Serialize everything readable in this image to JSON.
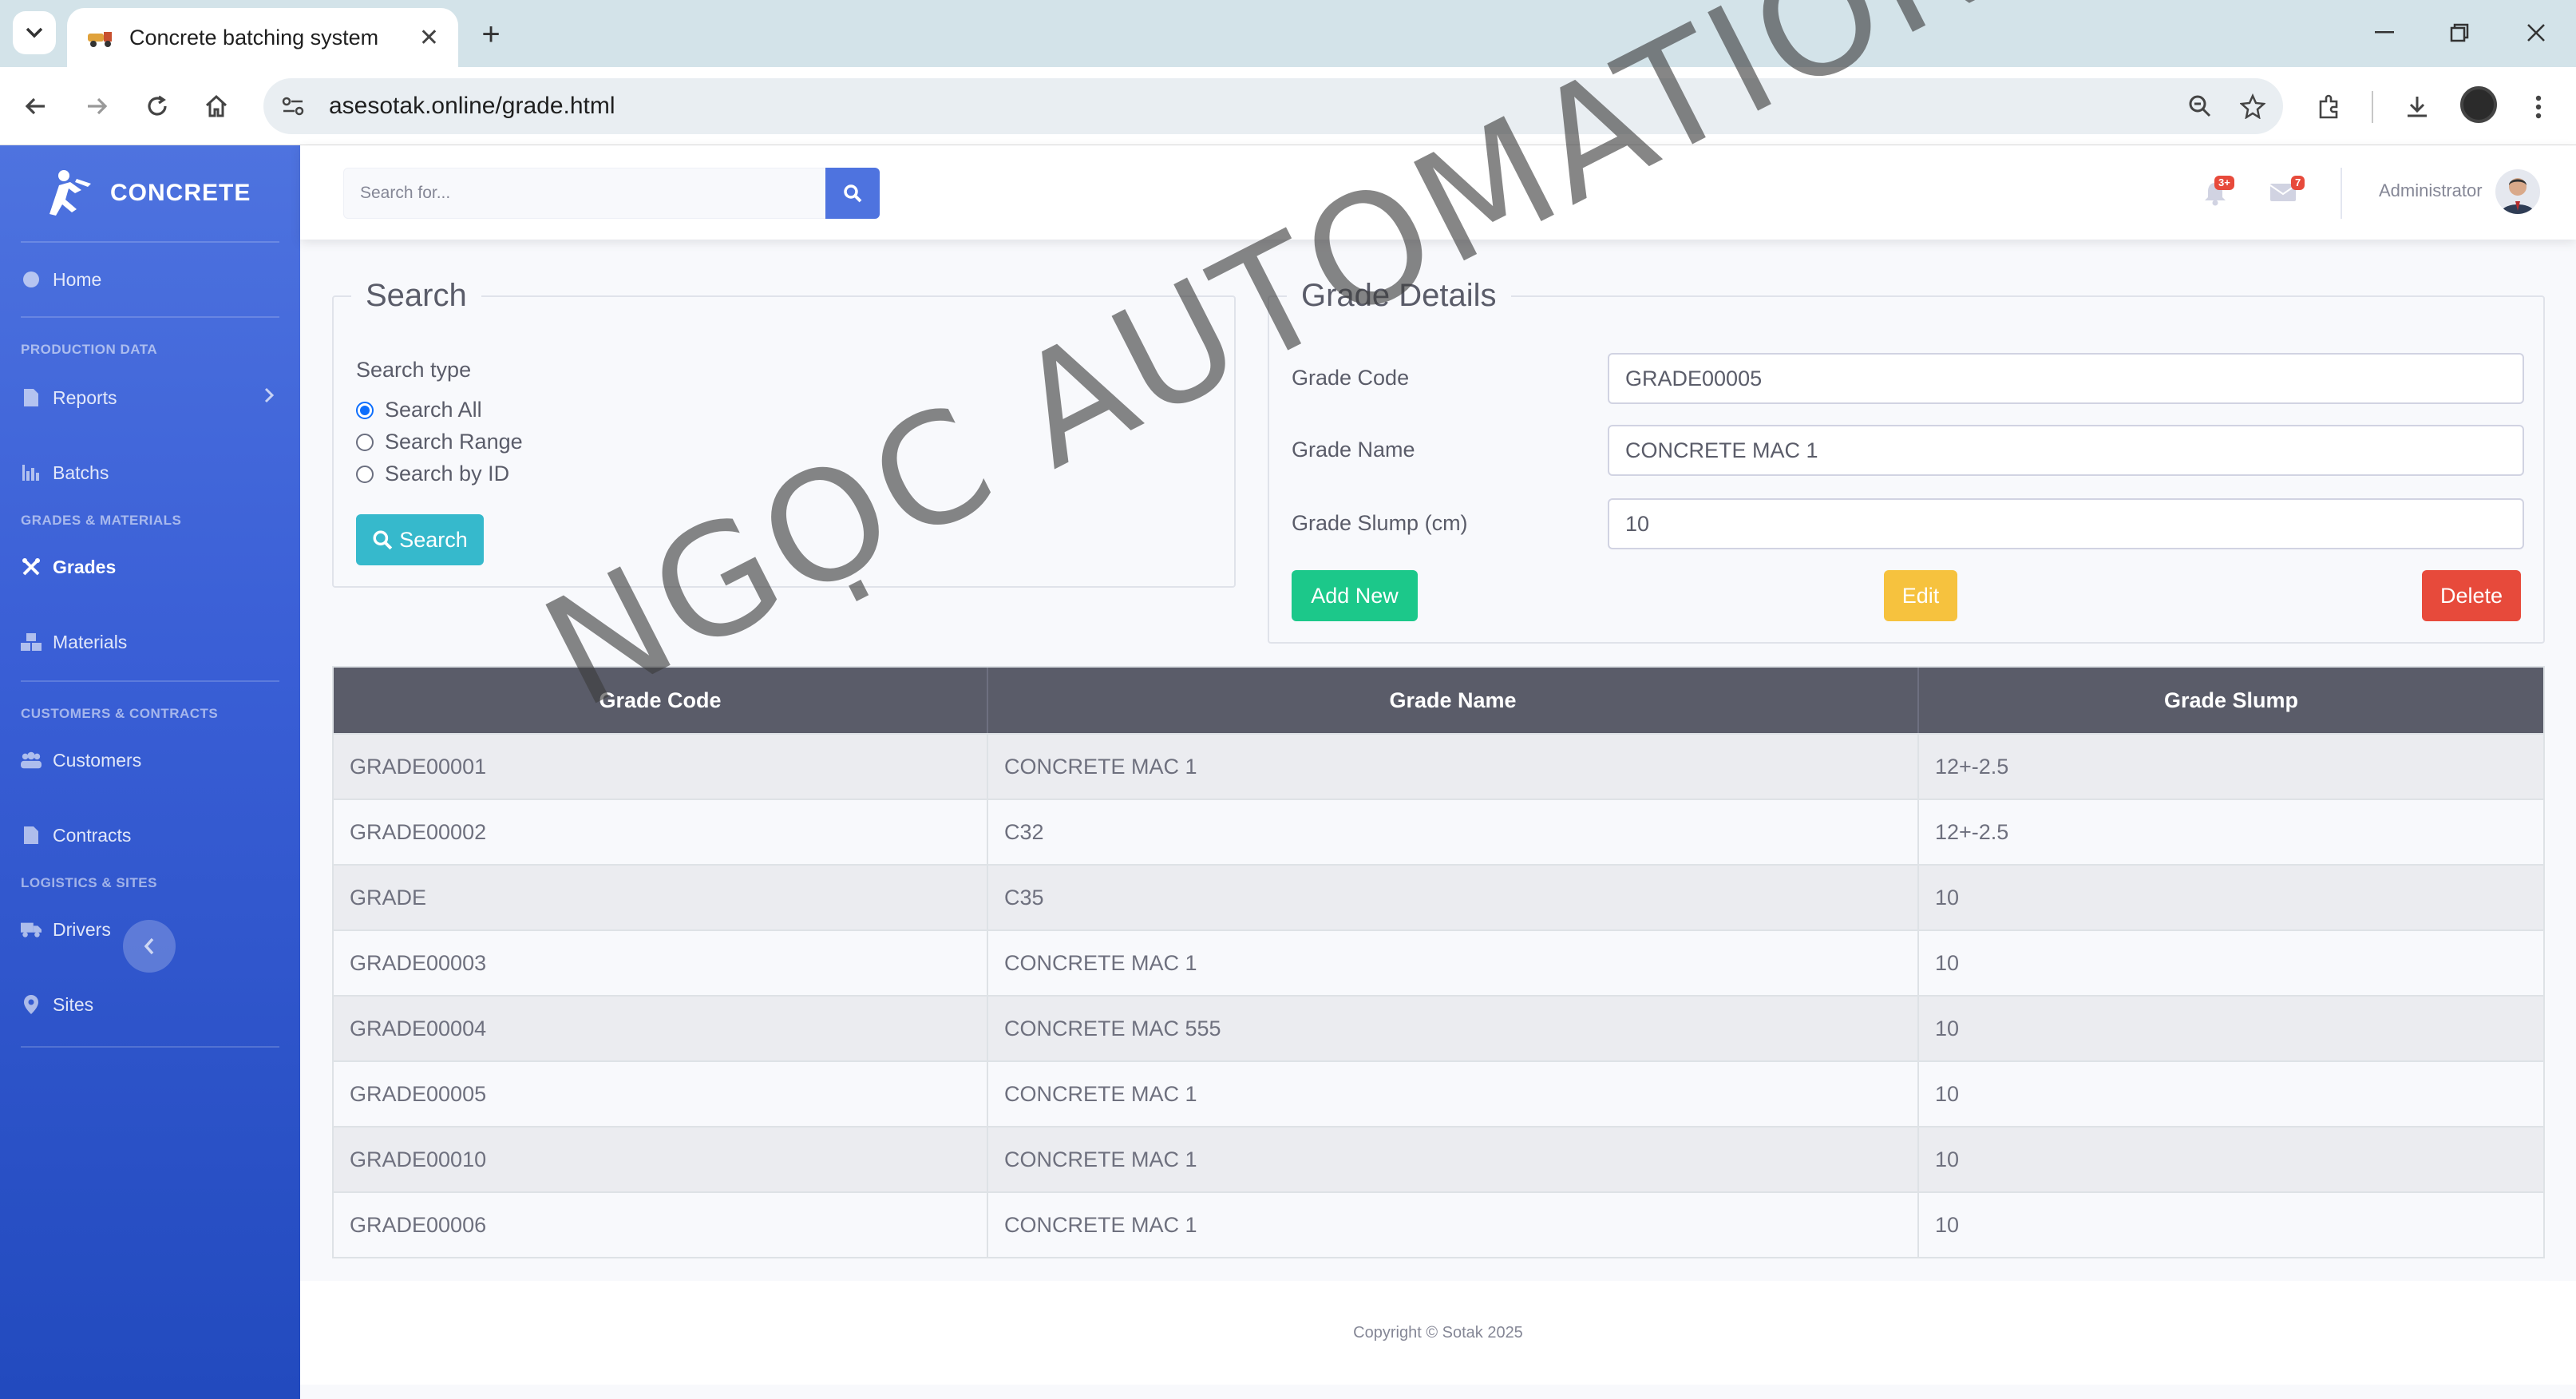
{
  "browser": {
    "tab_title": "Concrete batching system",
    "url": "asesotak.online/grade.html"
  },
  "sidebar": {
    "brand": "CONCRETE",
    "home": "Home",
    "heading_production": "PRODUCTION DATA",
    "reports": "Reports",
    "batchs": "Batchs",
    "heading_grades": "GRADES & MATERIALS",
    "grades": "Grades",
    "materials": "Materials",
    "heading_customers": "CUSTOMERS & CONTRACTS",
    "customers": "Customers",
    "contracts": "Contracts",
    "heading_logistics": "LOGISTICS & SITES",
    "drivers": "Drivers",
    "sites": "Sites"
  },
  "topbar": {
    "search_placeholder": "Search for...",
    "alerts_badge": "3+",
    "messages_badge": "7",
    "user_name": "Administrator"
  },
  "search_panel": {
    "title": "Search",
    "search_type_label": "Search type",
    "options": [
      "Search All",
      "Search Range",
      "Search by ID"
    ],
    "selected": "Search All",
    "search_button": "Search"
  },
  "grade_details": {
    "title": "Grade Details",
    "code_label": "Grade Code",
    "code_value": "GRADE00005",
    "name_label": "Grade Name",
    "name_value": "CONCRETE MAC 1",
    "slump_label": "Grade Slump (cm)",
    "slump_value": "10",
    "add_button": "Add New",
    "edit_button": "Edit",
    "delete_button": "Delete"
  },
  "table": {
    "headers": [
      "Grade Code",
      "Grade Name",
      "Grade Slump"
    ],
    "rows": [
      [
        "GRADE00001",
        "CONCRETE MAC 1",
        "12+-2.5"
      ],
      [
        "GRADE00002",
        "C32",
        "12+-2.5"
      ],
      [
        "GRADE",
        "C35",
        "10"
      ],
      [
        "GRADE00003",
        "CONCRETE MAC 1",
        "10"
      ],
      [
        "GRADE00004",
        "CONCRETE MAC 555",
        "10"
      ],
      [
        "GRADE00005",
        "CONCRETE MAC 1",
        "10"
      ],
      [
        "GRADE00010",
        "CONCRETE MAC 1",
        "10"
      ],
      [
        "GRADE00006",
        "CONCRETE MAC 1",
        "10"
      ]
    ]
  },
  "footer": "Copyright © Sotak 2025",
  "watermark": "NGỌC AUTOMATION",
  "colors": {
    "primary": "#4e73df",
    "info": "#36b9cc",
    "success": "#1cc88a",
    "warning": "#f6c23e",
    "danger": "#e74a3b",
    "table_header": "#5a5c69"
  }
}
